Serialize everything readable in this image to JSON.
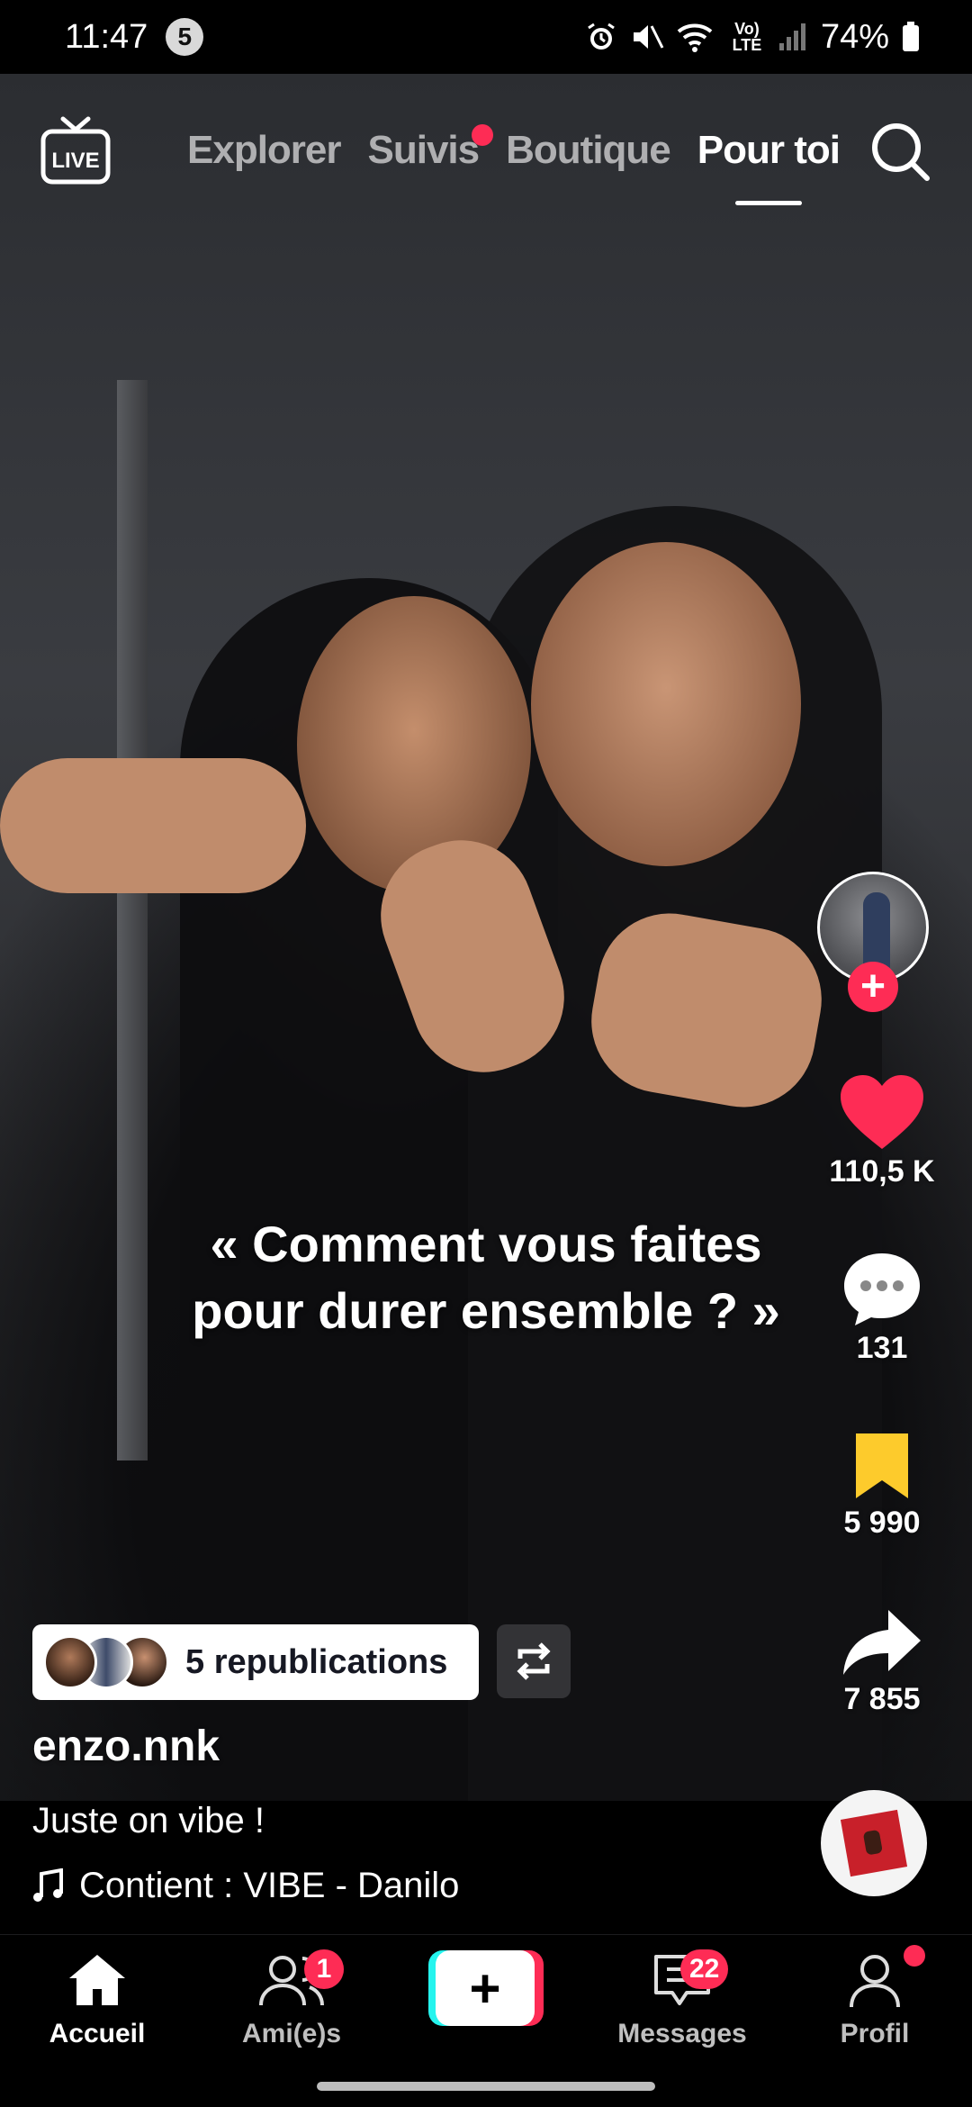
{
  "status_bar": {
    "time": "11:47",
    "notification_count": "5",
    "battery": "74%",
    "network": "Vo) LTE"
  },
  "top_nav": {
    "live_label": "LIVE",
    "tabs": [
      {
        "label": "Explorer",
        "active": false,
        "has_dot": false
      },
      {
        "label": "Suivis",
        "active": false,
        "has_dot": true
      },
      {
        "label": "Boutique",
        "active": false,
        "has_dot": false
      },
      {
        "label": "Pour toi",
        "active": true,
        "has_dot": false
      }
    ]
  },
  "video": {
    "caption_line1": "« Comment vous faites",
    "caption_line2": "pour durer ensemble ? »"
  },
  "actions": {
    "likes": "110,5 K",
    "comments": "131",
    "saves": "5 990",
    "shares": "7 855"
  },
  "post": {
    "reposts_label": "5 republications",
    "username": "enzo.nnk",
    "description": "Juste on vibe !",
    "sound": "Contient : VIBE - Danilo"
  },
  "bottom_nav": {
    "home": "Accueil",
    "friends": "Ami(e)s",
    "friends_badge": "1",
    "messages": "Messages",
    "messages_badge": "22",
    "profile": "Profil"
  },
  "colors": {
    "accent": "#fe2c55",
    "cyan": "#25f4ee",
    "bookmark": "#fdcb2c"
  }
}
